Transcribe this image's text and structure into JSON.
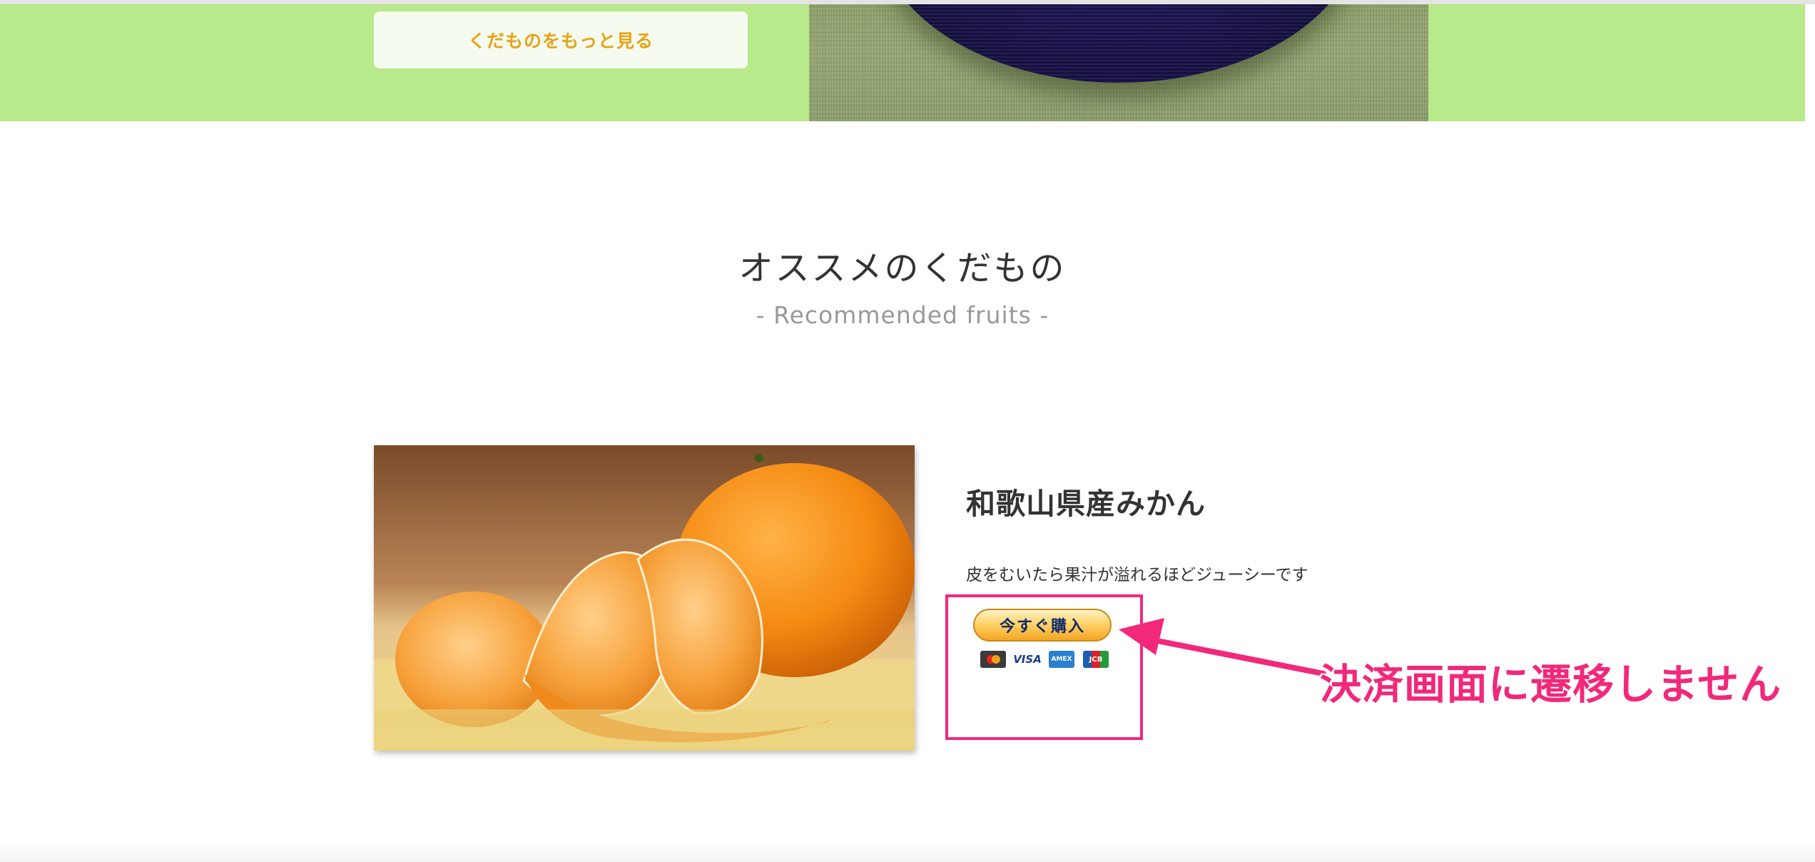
{
  "hero": {
    "more_button_label": "くだものをもっと見る"
  },
  "section": {
    "title": "オススメのくだもの",
    "subtitle": "- Recommended fruits -"
  },
  "product": {
    "name": "和歌山県産みかん",
    "description": "皮をむいたら果汁が溢れるほどジューシーです",
    "buy_button_label": "今すぐ購入",
    "cards": [
      "MasterCard",
      "VISA",
      "AMEX",
      "JCB"
    ]
  },
  "annotation": {
    "text": "決済画面に遷移しません",
    "color": "#f2287a"
  },
  "colors": {
    "hero_green": "#b8e98a",
    "button_text": "#e8a317"
  }
}
